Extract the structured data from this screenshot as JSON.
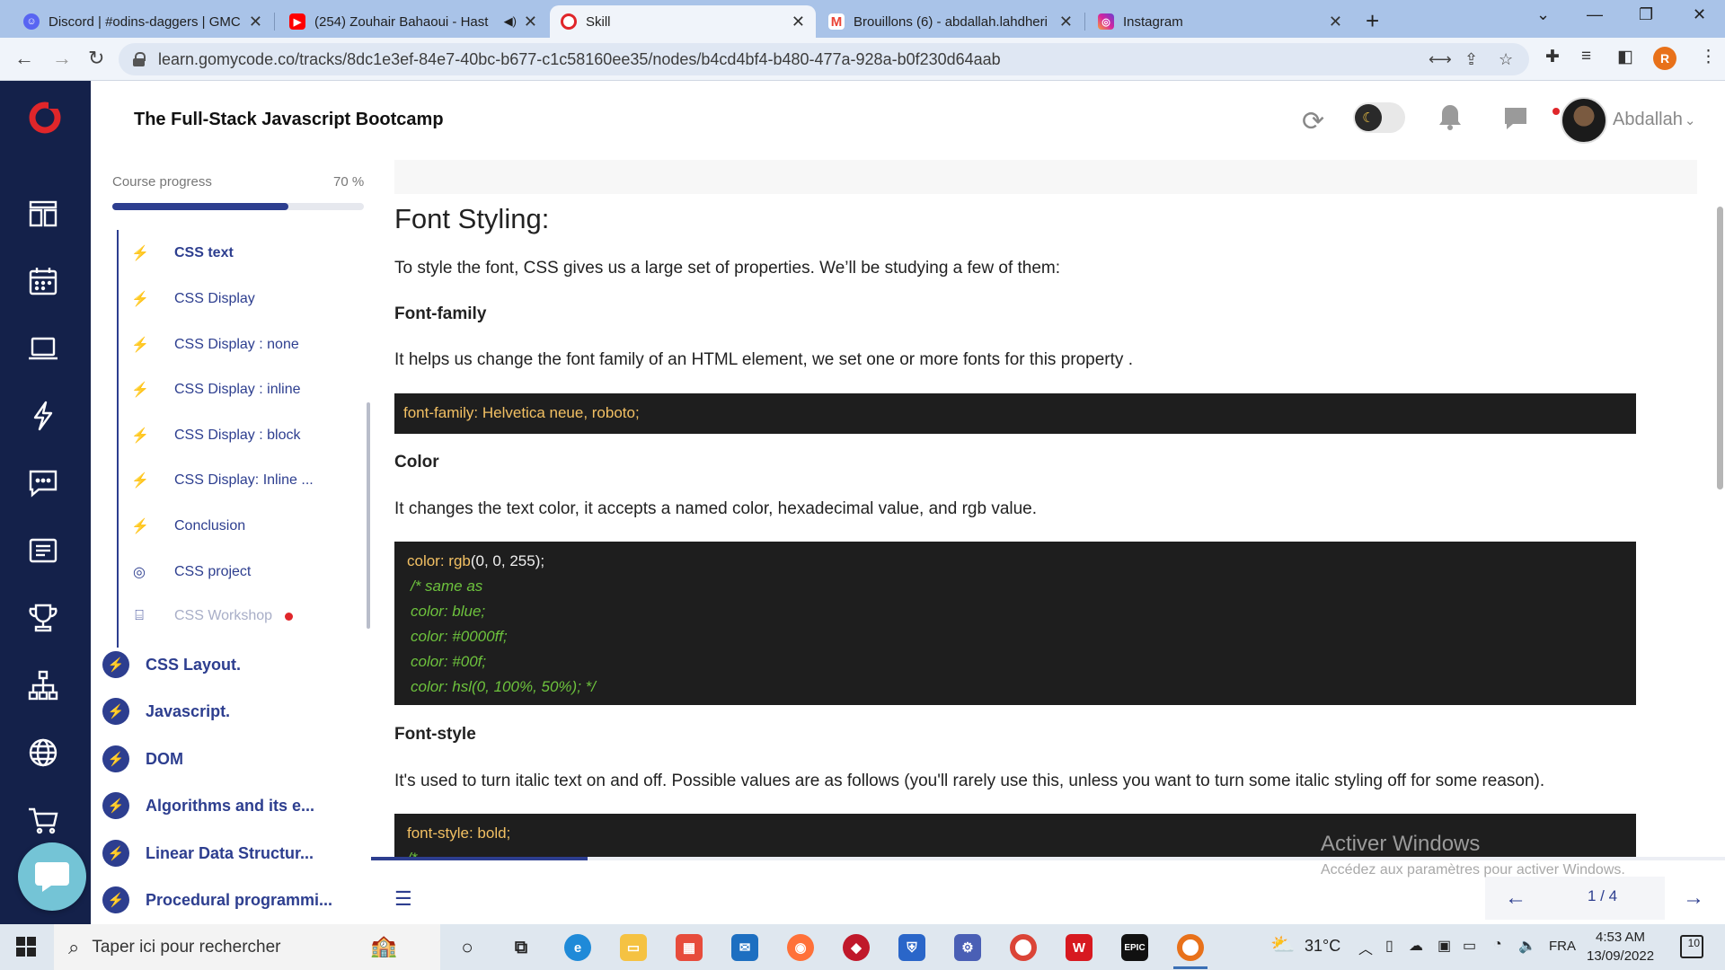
{
  "browser": {
    "tabs": [
      {
        "title": "Discord | #odins-daggers | GMC",
        "icon": "discord-icon",
        "color": "#5865f2",
        "active": false
      },
      {
        "title": "(254) Zouhair Bahaoui - Hast",
        "icon": "youtube-icon",
        "color": "#ff0000",
        "active": false
      },
      {
        "title": "Skill",
        "icon": "gomycode-icon",
        "color": "#e0262a",
        "active": true
      },
      {
        "title": "Brouillons (6) - abdallah.lahdheri",
        "icon": "gmail-icon",
        "color": "#ea4335",
        "active": false
      },
      {
        "title": "Instagram",
        "icon": "instagram-icon",
        "color": "#d6249f",
        "active": false
      }
    ],
    "url": "learn.gomycode.co/tracks/8dc1e3ef-84e7-40bc-b677-c1c58160ee35/nodes/b4cd4bf4-b480-477a-928a-b0f230d64aab",
    "profile_initial": "R"
  },
  "header": {
    "course_title": "The Full-Stack Javascript Bootcamp",
    "user_name": "Abdallah"
  },
  "sidebar": {
    "progress_label": "Course progress",
    "progress_text": "70 %",
    "progress_value": 0.7,
    "lessons": [
      {
        "label": "CSS text",
        "icon": "lightning-icon",
        "state": "active"
      },
      {
        "label": "CSS Display",
        "icon": "lightning-icon",
        "state": "normal"
      },
      {
        "label": "CSS Display : none",
        "icon": "lightning-icon",
        "state": "normal"
      },
      {
        "label": "CSS Display : inline",
        "icon": "lightning-icon",
        "state": "normal"
      },
      {
        "label": "CSS Display : block",
        "icon": "lightning-icon",
        "state": "normal"
      },
      {
        "label": "CSS Display: Inline ...",
        "icon": "lightning-icon",
        "state": "normal"
      },
      {
        "label": "Conclusion",
        "icon": "lightning-icon",
        "state": "normal"
      },
      {
        "label": "CSS project",
        "icon": "target-icon",
        "state": "normal"
      },
      {
        "label": "CSS Workshop",
        "icon": "workshop-icon",
        "state": "muted"
      }
    ],
    "modules": [
      {
        "label": "CSS Layout."
      },
      {
        "label": "Javascript."
      },
      {
        "label": "DOM"
      },
      {
        "label": "Algorithms and its e..."
      },
      {
        "label": "Linear Data Structur..."
      },
      {
        "label": "Procedural programmi..."
      }
    ]
  },
  "content": {
    "title": "Font Styling:",
    "intro": "To style the font, CSS gives us a large set of properties. We’ll be studying a few of them:",
    "font_family": {
      "heading": "Font-family",
      "text": "It helps us change the font family of an HTML element, we set one or more fonts for this property .",
      "code": "font-family: Helvetica neue, roboto;"
    },
    "color": {
      "heading": "Color",
      "text": "It changes the text color, it accepts a named color, hexadecimal value, and rgb value.",
      "code_prop": "color: rgb",
      "code_rest": "(0, 0, 255);",
      "comments": [
        "/* same as",
        "color: blue;",
        "color: #0000ff;",
        "color: #00f;",
        "color: hsl(0, 100%, 50%); */"
      ]
    },
    "font_style": {
      "heading": "Font-style",
      "text": "It's used to turn italic text on and off. Possible values are as follows (you'll rarely use this, unless you want to turn some italic styling off for some reason).",
      "code": "font-style: bold;",
      "code_comment": "/*"
    }
  },
  "watermark": {
    "title": "Activer Windows",
    "subtitle": "Accédez aux paramètres pour activer Windows."
  },
  "pager": {
    "page_text": "1 / 4",
    "progress_value": 0.16
  },
  "taskbar": {
    "search_placeholder": "Taper ici pour rechercher",
    "weather": "31°C",
    "language": "FRA",
    "time": "4:53 AM",
    "date": "13/09/2022",
    "notifications": "10"
  },
  "colors": {
    "brand_navy": "#14214a",
    "accent_blue": "#2d3e8f",
    "brand_red": "#e0262a",
    "code_bg": "#1e1e1e",
    "code_property": "#f2c063",
    "code_comment": "#6dc23d"
  }
}
